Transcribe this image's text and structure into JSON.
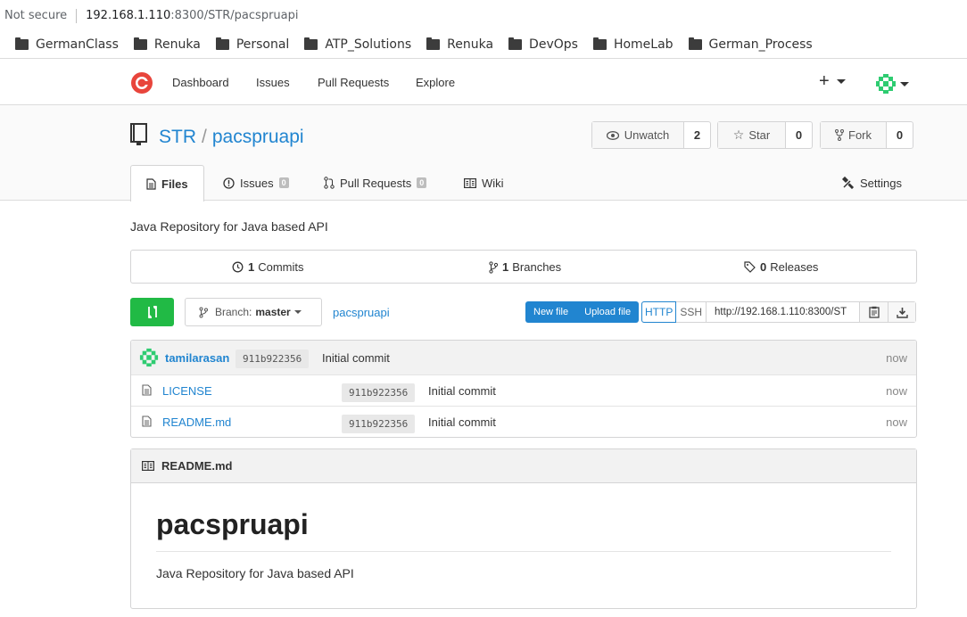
{
  "browser": {
    "security_label": "Not secure",
    "url_host": "192.168.1.110",
    "url_rest": ":8300/STR/pacspruapi"
  },
  "bookmarks": [
    "GermanClass",
    "Renuka",
    "Personal",
    "ATP_Solutions",
    "Renuka",
    "DevOps",
    "HomeLab",
    "German_Process"
  ],
  "nav": {
    "items": [
      "Dashboard",
      "Issues",
      "Pull Requests",
      "Explore"
    ],
    "plus_label": "+"
  },
  "repo": {
    "owner": "STR",
    "separator": "/",
    "name": "pacspruapi",
    "watch": {
      "label": "Unwatch",
      "count": "2"
    },
    "star": {
      "label": "Star",
      "count": "0"
    },
    "fork": {
      "label": "Fork",
      "count": "0"
    },
    "description": "Java Repository for Java based API"
  },
  "tabs": {
    "files": "Files",
    "issues": "Issues",
    "issues_count": "0",
    "pulls": "Pull Requests",
    "pulls_count": "0",
    "wiki": "Wiki",
    "settings": "Settings"
  },
  "stats": {
    "commits_num": "1",
    "commits_label": "Commits",
    "branches_num": "1",
    "branches_label": "Branches",
    "releases_num": "0",
    "releases_label": "Releases"
  },
  "toolbar": {
    "branch_prefix": "Branch:",
    "branch_name": "master",
    "breadcrumb": "pacspruapi",
    "new_file": "New file",
    "upload_file": "Upload file",
    "http": "HTTP",
    "ssh": "SSH",
    "clone_url": "http://192.168.1.110:8300/ST"
  },
  "latest_commit": {
    "author": "tamilarasan",
    "sha": "911b922356",
    "message": "Initial commit",
    "time": "now"
  },
  "files": [
    {
      "name": "LICENSE",
      "sha": "911b922356",
      "message": "Initial commit",
      "time": "now"
    },
    {
      "name": "README.md",
      "sha": "911b922356",
      "message": "Initial commit",
      "time": "now"
    }
  ],
  "readme": {
    "filename": "README.md",
    "heading": "pacspruapi",
    "body": "Java Repository for Java based API"
  },
  "colors": {
    "link": "#2185d0",
    "green": "#21ba45",
    "logo": "#e8453c",
    "avatar": "#2ecc71"
  }
}
